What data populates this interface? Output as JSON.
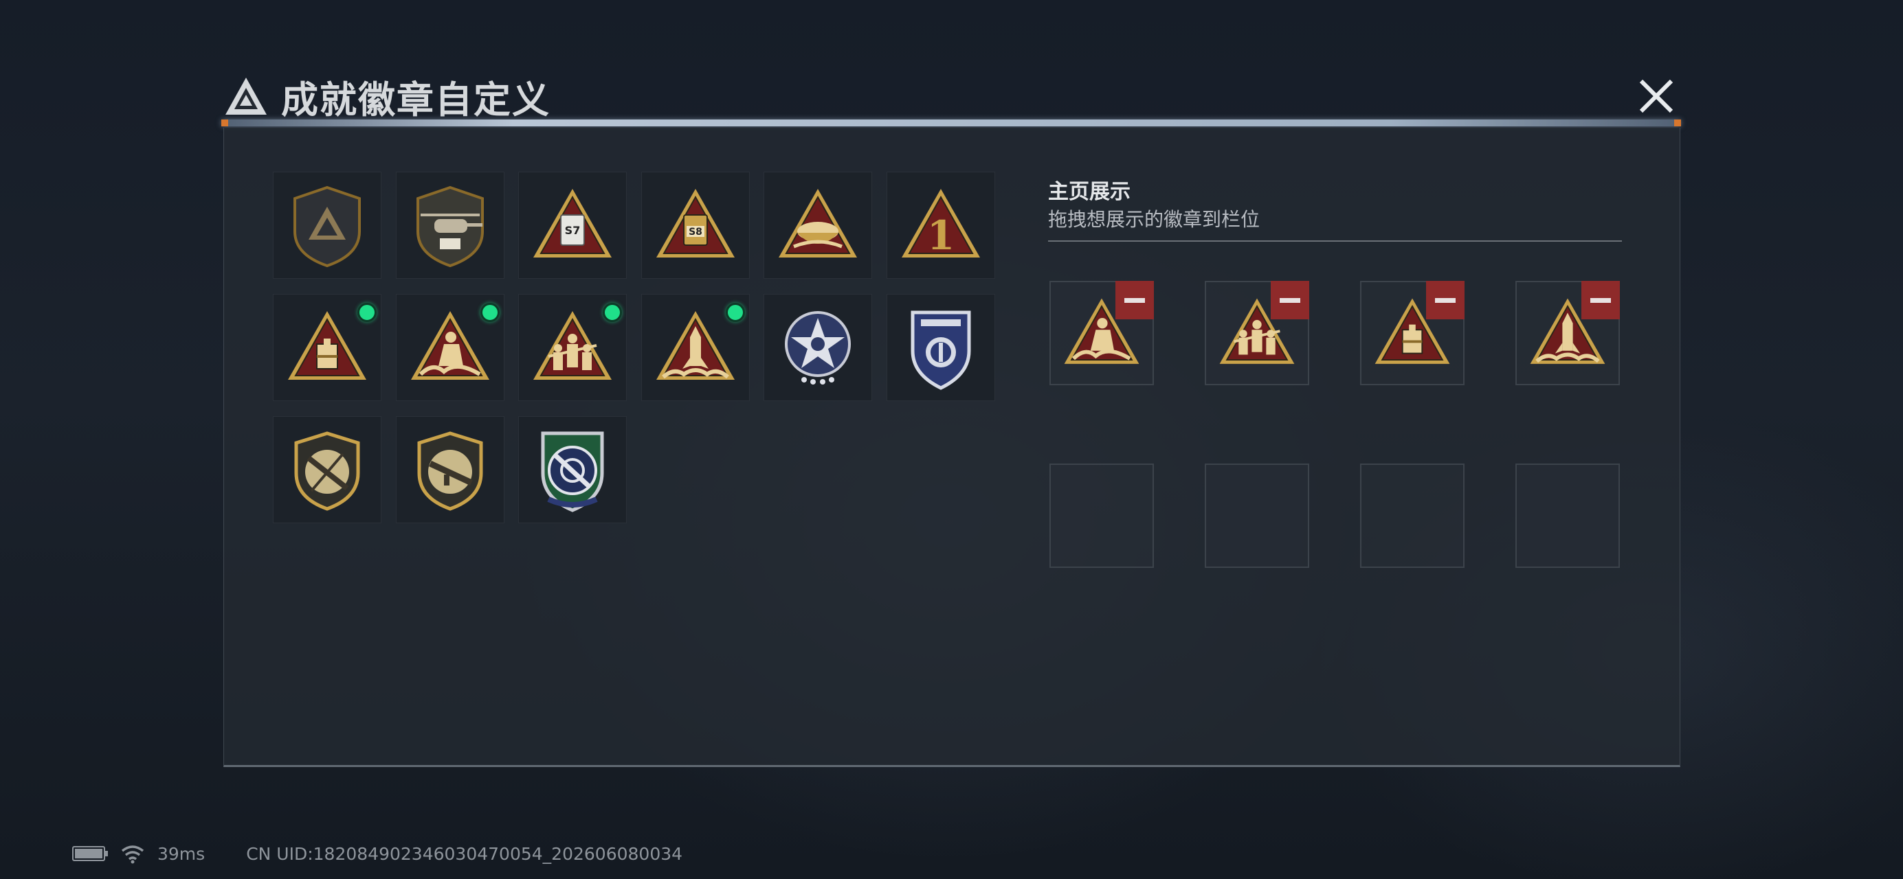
{
  "header": {
    "title": "成就徽章自定义",
    "logo_icon": "triangle-logo-icon",
    "close_icon": "close-icon"
  },
  "badge_grid": {
    "badges": [
      {
        "icon": "shield-triangle-badge",
        "new": false
      },
      {
        "icon": "helicopter-badge",
        "new": false
      },
      {
        "icon": "s7-triangle-badge",
        "new": false
      },
      {
        "icon": "s8-triangle-badge",
        "new": false
      },
      {
        "icon": "bowl-triangle-badge",
        "new": false
      },
      {
        "icon": "number-one-triangle-badge",
        "new": false
      },
      {
        "icon": "supply-box-triangle-badge",
        "new": true
      },
      {
        "icon": "kneeling-soldier-triangle-badge",
        "new": true
      },
      {
        "icon": "squad-triangle-badge",
        "new": true
      },
      {
        "icon": "missile-triangle-badge",
        "new": true
      },
      {
        "icon": "star-emblem-badge",
        "new": false
      },
      {
        "icon": "police-shield-badge",
        "new": false
      },
      {
        "icon": "crossed-rifle-shield-badge",
        "new": false
      },
      {
        "icon": "rifle-shield-badge",
        "new": false
      },
      {
        "icon": "crosshair-green-shield-badge",
        "new": false
      }
    ],
    "colors": {
      "new_dot": "#1fe08a",
      "gold": "#c9a24a",
      "red": "#6e1c1c"
    }
  },
  "showcase": {
    "title": "主页展示",
    "subtitle": "拖拽想展示的徽章到栏位",
    "slots": [
      {
        "badge": "kneeling-soldier-triangle-badge",
        "filled": true
      },
      {
        "badge": "squad-triangle-badge",
        "filled": true
      },
      {
        "badge": "supply-box-triangle-badge",
        "filled": true
      },
      {
        "badge": "missile-triangle-badge",
        "filled": true
      },
      {
        "badge": "",
        "filled": false
      },
      {
        "badge": "",
        "filled": false
      },
      {
        "badge": "",
        "filled": false
      },
      {
        "badge": "",
        "filled": false
      }
    ],
    "remove_icon": "minus-icon",
    "remove_color": "#8e2a2a"
  },
  "status_bar": {
    "battery_icon": "battery-icon",
    "wifi_icon": "wifi-icon",
    "ping": "39ms",
    "uid": "CN UID:18208490234603047005​4_202606080034"
  }
}
